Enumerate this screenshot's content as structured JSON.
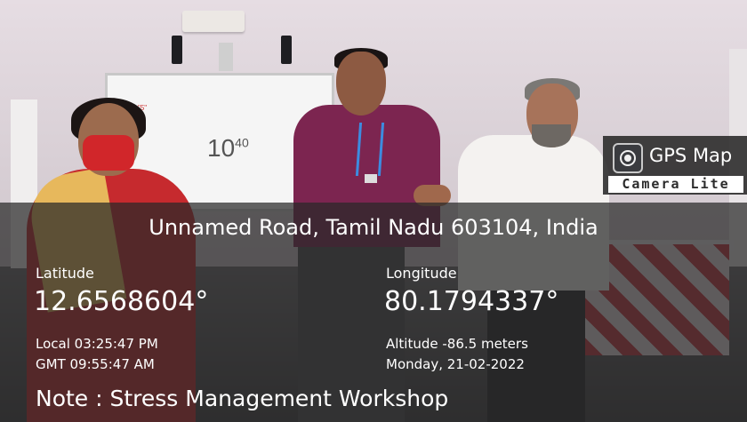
{
  "board": {
    "tab_text": "The \"5\"",
    "base": "10",
    "exponent": "40"
  },
  "badge": {
    "title": "GPS Map",
    "subtitle": "Camera Lite",
    "icon": "camera-pin-icon"
  },
  "location": {
    "address": "Unnamed Road, Tamil Nadu 603104, India",
    "latitude_label": "Latitude",
    "latitude_value": "12.6568604°",
    "longitude_label": "Longitude",
    "longitude_value": "80.1794337°",
    "local_time": "Local 03:25:47 PM",
    "gmt_time": "GMT 09:55:47 AM",
    "altitude": "Altitude -86.5 meters",
    "date": "Monday, 21-02-2022",
    "note": "Note : Stress Management Workshop"
  },
  "colors": {
    "overlay": "#282828",
    "text": "#ffffff",
    "shirt_maroon": "#7c2550",
    "saree_red": "#c62a2e"
  }
}
